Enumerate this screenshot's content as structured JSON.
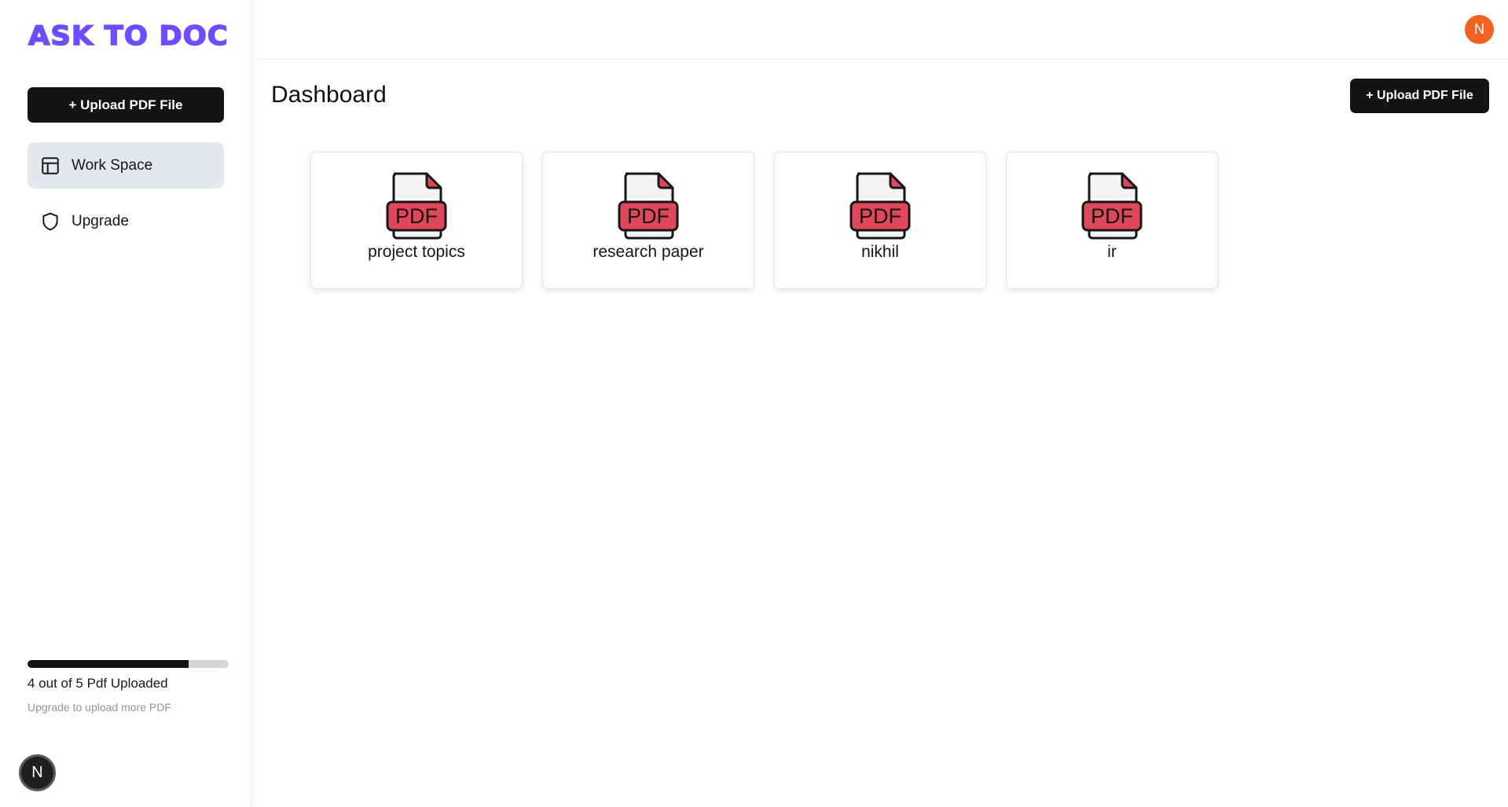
{
  "app": {
    "logo": "ASK TO DOC",
    "brand_color": "#6d4dff"
  },
  "sidebar": {
    "upload_label": "+ Upload PDF File",
    "items": [
      {
        "label": "Work Space",
        "icon": "layout-icon",
        "active": true
      },
      {
        "label": "Upgrade",
        "icon": "shield-icon",
        "active": false
      }
    ],
    "usage": {
      "uploaded": 4,
      "limit": 5,
      "progress_fraction": 0.8,
      "text": "4 out of 5 Pdf Uploaded",
      "hint": "Upgrade to upload more PDF"
    },
    "avatar_initial": "N"
  },
  "header": {
    "avatar_initial": "N",
    "avatar_color": "#f26222"
  },
  "main": {
    "title": "Dashboard",
    "upload_label": "+ Upload PDF File",
    "files": [
      {
        "name": "project topics",
        "icon": "pdf-file-icon"
      },
      {
        "name": "research paper",
        "icon": "pdf-file-icon"
      },
      {
        "name": "nikhil",
        "icon": "pdf-file-icon"
      },
      {
        "name": "ir",
        "icon": "pdf-file-icon"
      }
    ],
    "file_badge": "PDF",
    "pdf_color": "#e0475b"
  }
}
